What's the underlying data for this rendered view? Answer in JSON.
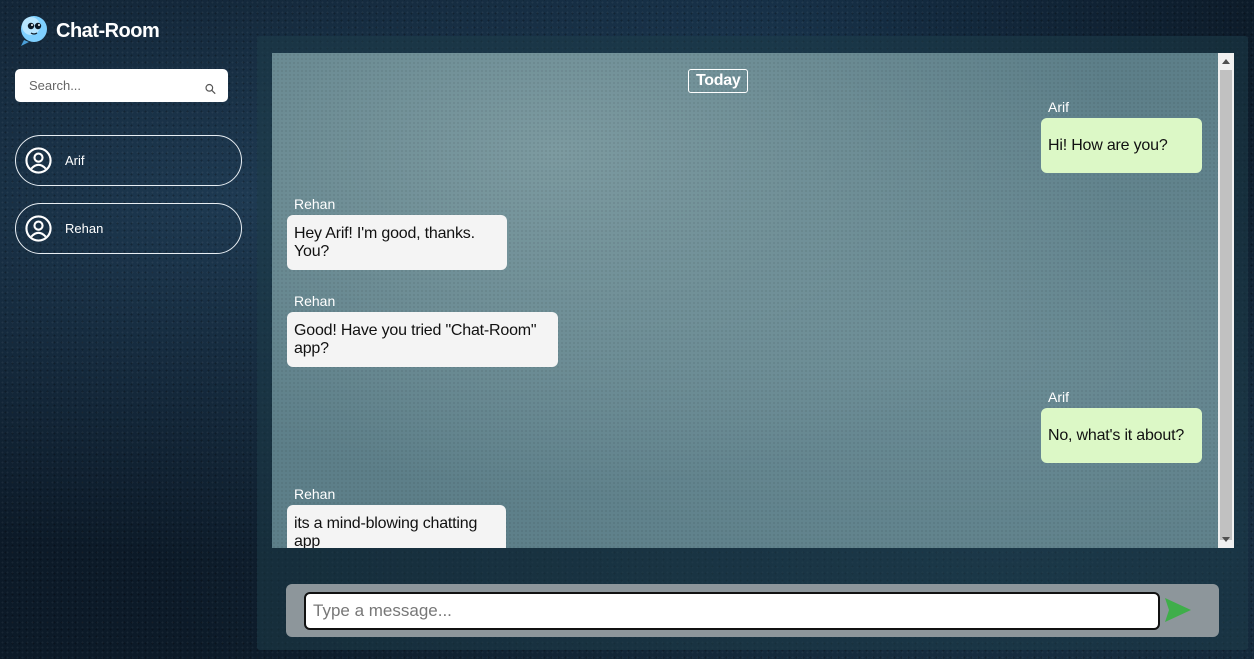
{
  "app": {
    "name": "Chat-Room"
  },
  "sidebar": {
    "search_placeholder": "Search...",
    "contacts": [
      {
        "name": "Arif"
      },
      {
        "name": "Rehan"
      }
    ]
  },
  "chat": {
    "day_label": "Today",
    "messages": [
      {
        "sender": "Arif",
        "text": "Hi! How are you?",
        "direction": "outgoing"
      },
      {
        "sender": "Rehan",
        "text": "Hey Arif! I'm good, thanks. You?",
        "direction": "incoming"
      },
      {
        "sender": "Rehan",
        "text": "Good! Have you tried \"Chat-Room\" app?",
        "direction": "incoming"
      },
      {
        "sender": "Arif",
        "text": "No, what's it about?",
        "direction": "outgoing"
      },
      {
        "sender": "Rehan",
        "text": "its a mind-blowing chatting app",
        "direction": "incoming"
      }
    ]
  },
  "composer": {
    "placeholder": "Type a message...",
    "send_icon": "send-arrow-icon"
  },
  "colors": {
    "incoming_bubble": "#f4f4f4",
    "outgoing_bubble": "#dcf8c6",
    "send_accent": "#3fae4a"
  }
}
